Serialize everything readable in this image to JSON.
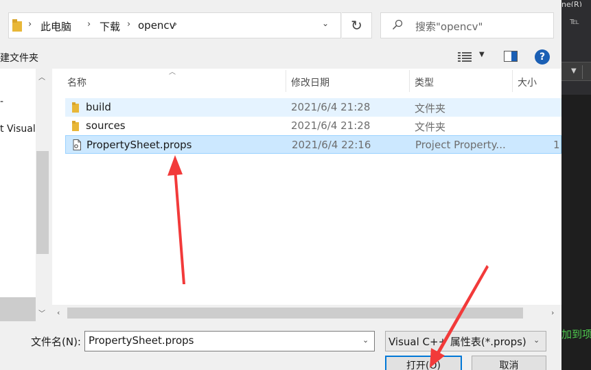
{
  "background_app": {
    "top_text": "ne(R)",
    "toolbar_glyph": "℡",
    "green_text": "加到项"
  },
  "address_bar": {
    "breadcrumbs": [
      "此电脑",
      "下载",
      "opencv"
    ]
  },
  "search": {
    "placeholder": "搜索\"opencv\""
  },
  "toolbar": {
    "new_folder_label": "建文件夹",
    "help_label": "?"
  },
  "nav_pane": {
    "items": [
      "-",
      "t Visual"
    ]
  },
  "columns": {
    "name": "名称",
    "date": "修改日期",
    "type": "类型",
    "size": "大小"
  },
  "files": [
    {
      "name": "build",
      "date": "2021/6/4 21:28",
      "type": "文件夹",
      "size": "",
      "icon": "folder-icon"
    },
    {
      "name": "sources",
      "date": "2021/6/4 21:28",
      "type": "文件夹",
      "size": "",
      "icon": "folder-icon"
    },
    {
      "name": "PropertySheet.props",
      "date": "2021/6/4 22:16",
      "type": "Project Property...",
      "size": "1",
      "icon": "property-file-icon"
    }
  ],
  "bottom": {
    "filename_label": "文件名(N):",
    "filename_value": "PropertySheet.props",
    "filter_value": "Visual C++ 属性表(*.props)",
    "open_label": "打开(O)",
    "cancel_label": "取消"
  },
  "colors": {
    "accent": "#0078d7",
    "selection": "#cce8ff",
    "hover": "#e5f3ff",
    "annotation_arrow": "#f23a3a",
    "folder": "#e8b738"
  }
}
